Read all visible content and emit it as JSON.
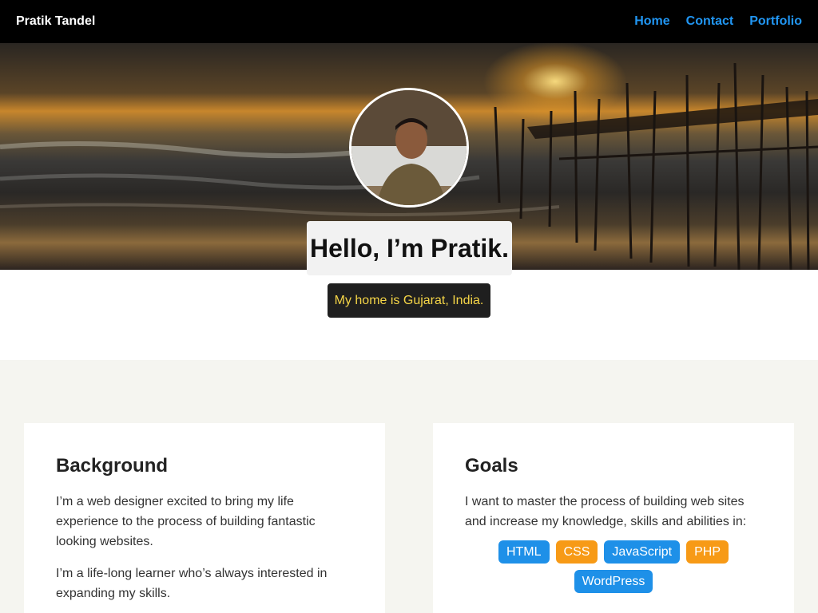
{
  "nav": {
    "brand": "Pratik Tandel",
    "links": [
      "Home",
      "Contact",
      "Portfolio"
    ]
  },
  "hero": {
    "greeting": "Hello, I’m Pratik.",
    "home": "My home is Gujarat, India."
  },
  "background": {
    "title": "Background",
    "paragraphs": [
      "I’m a web designer excited to bring my life experience to the process of building fantastic looking websites.",
      "I’m a life-long learner who’s always interested in expanding my skills."
    ]
  },
  "goals": {
    "title": "Goals",
    "text": "I want to master the process of building web sites and increase my knowledge, skills and abilities in:",
    "skills": [
      "HTML",
      "CSS",
      "JavaScript",
      "PHP",
      "WordPress"
    ]
  },
  "colors": {
    "accent_blue": "#1e90e8",
    "accent_orange": "#f79a16",
    "nav_link": "#2196f3",
    "home_text": "#f5d547"
  }
}
